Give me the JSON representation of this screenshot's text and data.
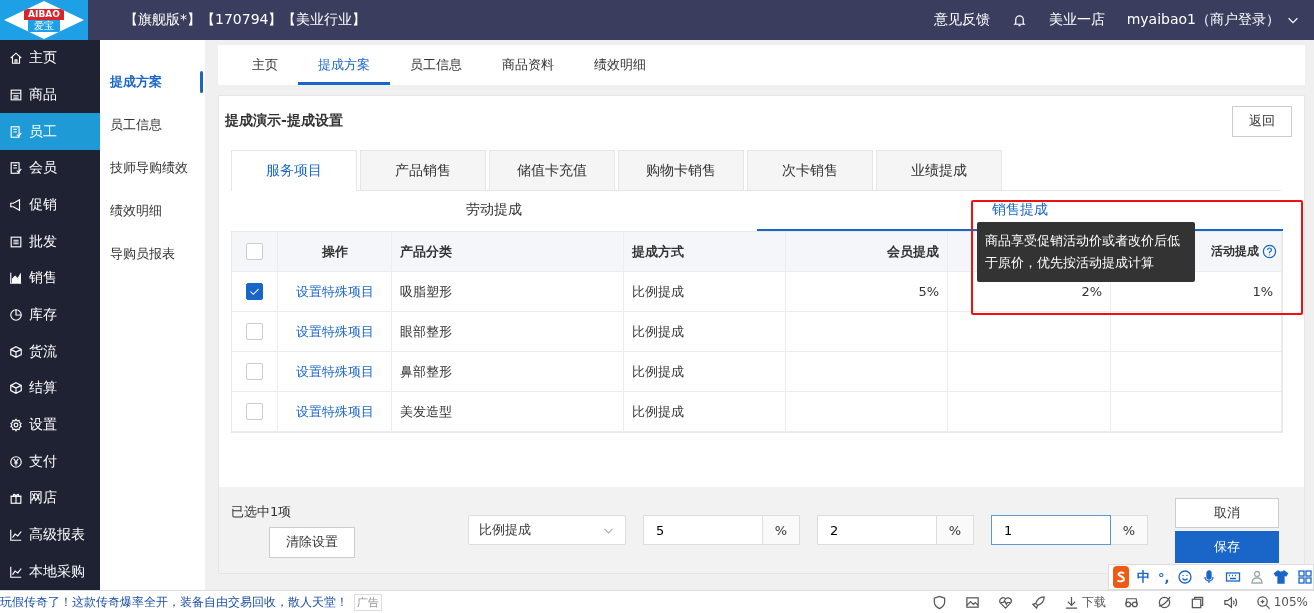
{
  "logo": {
    "latin": "AIBAO",
    "chinese": "爱宝"
  },
  "header": {
    "edition": "【旗舰版*】【170794】【美业行业】",
    "feedback": "意见反馈",
    "store": "美业一店",
    "user": "myaibao1（商户登录）"
  },
  "sidebar": {
    "items": [
      {
        "label": "主页",
        "selected": false
      },
      {
        "label": "商品",
        "selected": false
      },
      {
        "label": "员工",
        "selected": true
      },
      {
        "label": "会员",
        "selected": false
      },
      {
        "label": "促销",
        "selected": false
      },
      {
        "label": "批发",
        "selected": false
      },
      {
        "label": "销售",
        "selected": false
      },
      {
        "label": "库存",
        "selected": false
      },
      {
        "label": "货流",
        "selected": false
      },
      {
        "label": "结算",
        "selected": false
      },
      {
        "label": "设置",
        "selected": false
      },
      {
        "label": "支付",
        "selected": false
      },
      {
        "label": "网店",
        "selected": false
      },
      {
        "label": "高级报表",
        "selected": false
      },
      {
        "label": "本地采购",
        "selected": false
      }
    ]
  },
  "subnav": {
    "items": [
      {
        "label": "提成方案",
        "selected": true
      },
      {
        "label": "员工信息",
        "selected": false
      },
      {
        "label": "技师导购绩效",
        "selected": false
      },
      {
        "label": "绩效明细",
        "selected": false
      },
      {
        "label": "导购员报表",
        "selected": false
      }
    ]
  },
  "top_tabs": [
    {
      "label": "主页",
      "selected": false
    },
    {
      "label": "提成方案",
      "selected": true
    },
    {
      "label": "员工信息",
      "selected": false
    },
    {
      "label": "商品资料",
      "selected": false
    },
    {
      "label": "绩效明细",
      "selected": false
    }
  ],
  "panel": {
    "title": "提成演示-提成设置",
    "back_button": "返回"
  },
  "category_tabs": [
    {
      "label": "服务项目",
      "selected": true
    },
    {
      "label": "产品销售",
      "selected": false
    },
    {
      "label": "储值卡充值",
      "selected": false
    },
    {
      "label": "购物卡销售",
      "selected": false
    },
    {
      "label": "次卡销售",
      "selected": false
    },
    {
      "label": "业绩提成",
      "selected": false
    }
  ],
  "sub_tabs": [
    {
      "label": "劳动提成",
      "selected": false
    },
    {
      "label": "销售提成",
      "selected": true
    }
  ],
  "table": {
    "all_checked": false,
    "columns": [
      "操作",
      "产品分类",
      "提成方式",
      "会员提成"
    ],
    "help_column": "活动提成",
    "rows": [
      {
        "checked": true,
        "action": "设置特殊项目",
        "category": "吸脂塑形",
        "method": "比例提成",
        "member": "5%",
        "retail": "2%",
        "activity": "1%"
      },
      {
        "checked": false,
        "action": "设置特殊项目",
        "category": "眼部整形",
        "method": "比例提成"
      },
      {
        "checked": false,
        "action": "设置特殊项目",
        "category": "鼻部整形",
        "method": "比例提成"
      },
      {
        "checked": false,
        "action": "设置特殊项目",
        "category": "美发造型",
        "method": "比例提成"
      }
    ]
  },
  "tooltip": "商品享受促销活动价或者改价后低于原价，优先按活动提成计算",
  "bulk_edit": {
    "selected_count": "已选中1项",
    "clear_button": "清除设置",
    "method": "比例提成",
    "inputs": [
      {
        "value": "5",
        "unit": "%",
        "focused": false
      },
      {
        "value": "2",
        "unit": "%",
        "focused": false
      },
      {
        "value": "1",
        "unit": "%",
        "focused": true
      }
    ],
    "cancel_button": "取消",
    "save_button": "保存"
  },
  "ime": {
    "mode": "中",
    "punctuation": "°,"
  },
  "status_bar": {
    "ad_text": "玩假传奇了！这款传奇爆率全开，装备自由交易回收，散人天堂！",
    "ad_badge": "广告",
    "download": "下载",
    "zoom": "105%"
  }
}
